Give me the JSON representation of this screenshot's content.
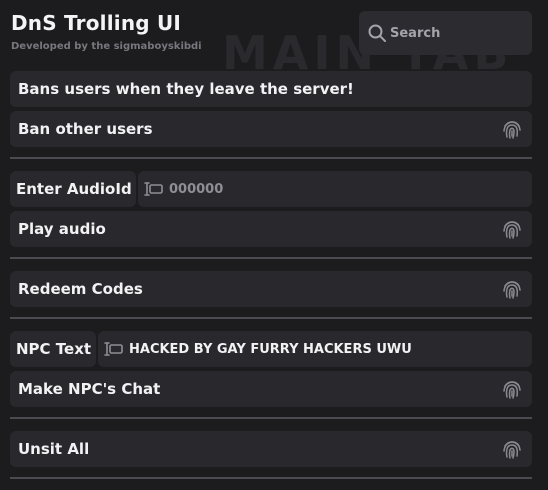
{
  "header": {
    "title": "DnS Trolling UI",
    "subtitle": "Developed by the sigmaboyskibdi",
    "watermark": "MAIN TAB"
  },
  "search": {
    "placeholder": "Search",
    "icon": "search-icon"
  },
  "items": {
    "bans_info": "Bans users when they leave the server!",
    "ban_other": "Ban other users",
    "audio_label": "Enter AudioId",
    "audio_value": "000000",
    "play_audio": "Play audio",
    "redeem_codes": "Redeem Codes",
    "npc_label": "NPC Text",
    "npc_value": "HACKED BY GAY FURRY HACKERS UWU",
    "make_npc_chat": "Make NPC's Chat",
    "unsit_all": "Unsit All"
  },
  "colors": {
    "background": "#1c1c1f",
    "row": "#29292d",
    "divider": "#4a4a50",
    "text": "#f2f2f4",
    "muted": "#77777d"
  }
}
